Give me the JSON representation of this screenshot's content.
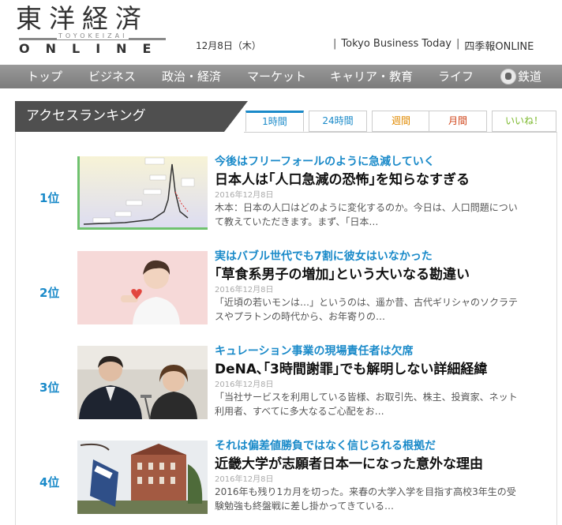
{
  "header": {
    "logo_jp": "東洋経済",
    "logo_sub": "TOYOKEIZAI",
    "logo_online": "ONLINE",
    "date": "12月8日（木）",
    "links": [
      "Tokyo Business Today",
      "四季報ONLINE"
    ]
  },
  "nav": {
    "items": [
      "トップ",
      "ビジネス",
      "政治・経済",
      "マーケット",
      "キャリア・教育",
      "ライフ",
      "鉄道"
    ]
  },
  "ranking": {
    "title": "アクセスランキング",
    "tabs": [
      "1時間",
      "24時間",
      "週間",
      "月間",
      "いいね！"
    ],
    "active_tab": "1時間",
    "items": [
      {
        "rank": "1位",
        "kicker": "今後はフリーフォールのように急減していく",
        "headline": "日本人は｢人口急減の恐怖｣を知らなすぎる",
        "date": "2016年12月8日",
        "excerpt": "木本：日本の人口はどのように変化するのか。今日は、人口問題について教えていただきます。まず、「日本…"
      },
      {
        "rank": "2位",
        "kicker": "実はバブル世代でも7割に彼女はいなかった",
        "headline": "｢草食系男子の増加｣という大いなる勘違い",
        "date": "2016年12月8日",
        "excerpt": "「近頃の若いモンは…」というのは、遥か昔、古代ギリシャのソクラテスやプラトンの時代から、お年寄りの…"
      },
      {
        "rank": "3位",
        "kicker": "キュレーション事業の現場責任者は欠席",
        "headline": "DeNA､｢3時間謝罪｣でも解明しない詳細経緯",
        "date": "2016年12月8日",
        "excerpt": "「当社サービスを利用している皆様、お取引先、株主、投資家、ネット利用者、すべてに多大なるご心配をお…"
      },
      {
        "rank": "4位",
        "kicker": "それは偏差値勝負ではなく信じられる根拠だ",
        "headline": "近畿大学が志願者日本一になった意外な理由",
        "date": "2016年12月8日",
        "excerpt": "2016年も残り1カ月を切った。来春の大学入学を目指す高校3年生の受験勉強も終盤戦に差し掛かってきている…"
      }
    ]
  },
  "colors": {
    "accent": "#1a8ac9",
    "nav_bg": "#8a8a8a",
    "tab_week": "#e08a00",
    "tab_month": "#d0451b",
    "tab_like": "#7ab82a"
  }
}
